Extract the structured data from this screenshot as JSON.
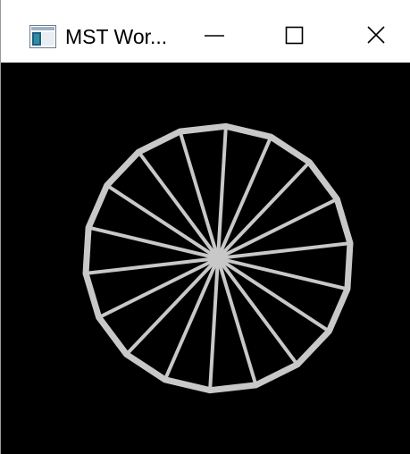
{
  "window": {
    "title": "MST Wor...",
    "icon": "window-app-icon"
  },
  "caption_buttons": {
    "minimize_icon": "minimize-icon",
    "maximize_icon": "maximize-icon",
    "close_icon": "close-icon"
  },
  "canvas": {
    "background": "#000000",
    "shape": "wheel",
    "spoke_count": 18,
    "stroke_color": "#c8c8c8"
  }
}
